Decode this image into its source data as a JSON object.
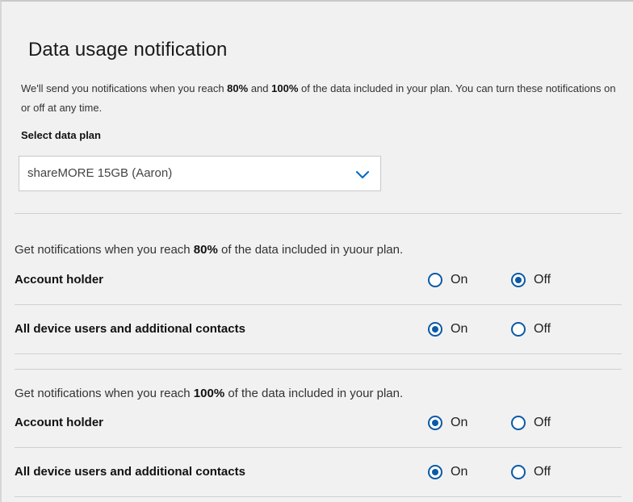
{
  "page": {
    "title": "Data usage notification",
    "intro_before_80": "We'll send you notifications when you reach ",
    "intro_80": "80%",
    "intro_and": " and ",
    "intro_100": "100%",
    "intro_after": " of the data included in your plan. You can turn these notifications on or off at any time."
  },
  "plan_select": {
    "label": "Select data plan",
    "value": "shareMORE 15GB (Aaron)",
    "icon": "chevron-down-icon",
    "icon_color": "#0b6fc4"
  },
  "sections": [
    {
      "text_before": "Get notifications when you reach ",
      "percent": "80%",
      "text_after": " of the data included in yuour plan.",
      "rows": [
        {
          "label": "Account holder",
          "on_label": "On",
          "off_label": "Off",
          "selected": "off"
        },
        {
          "label": "All device users and additional contacts",
          "on_label": "On",
          "off_label": "Off",
          "selected": "on"
        }
      ]
    },
    {
      "text_before": "Get notifications when you reach ",
      "percent": "100%",
      "text_after": " of the data included in your plan.",
      "rows": [
        {
          "label": "Account holder",
          "on_label": "On",
          "off_label": "Off",
          "selected": "on"
        },
        {
          "label": "All device users and additional contacts",
          "on_label": "On",
          "off_label": "Off",
          "selected": "on"
        }
      ]
    }
  ],
  "colors": {
    "radio_accent": "#0b5aa6",
    "background": "#f1f1f1"
  }
}
